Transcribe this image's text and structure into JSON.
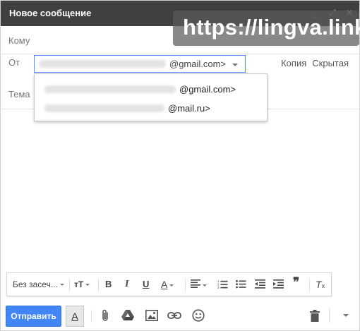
{
  "window": {
    "title": "Новое сообщение",
    "controls": [
      "minimize-icon",
      "expand-icon",
      "close-icon"
    ]
  },
  "watermark": {
    "text": "https://lingva.link"
  },
  "fields": {
    "to_label": "Кому",
    "from_label": "От",
    "from_value": "@gmail.com>",
    "cc_label": "Копия",
    "bcc_label": "Скрытая",
    "subject_label": "Тема"
  },
  "from_dropdown": {
    "options": [
      {
        "text": "@gmail.com>"
      },
      {
        "text": "@mail.ru>"
      }
    ]
  },
  "formatting": {
    "font_name": "Без засеч...",
    "icons": [
      "font-size-icon",
      "bold-icon",
      "italic-icon",
      "underline-icon",
      "text-color-icon",
      "align-icon",
      "numbered-list-icon",
      "bulleted-list-icon",
      "indent-less-icon",
      "indent-more-icon",
      "quote-icon",
      "remove-formatting-icon"
    ]
  },
  "bottom_toolbar": {
    "send_label": "Отправить",
    "format_toggle": "A",
    "icons": [
      "attach-icon",
      "drive-icon",
      "photo-icon",
      "link-icon",
      "emoji-icon",
      "trash-icon",
      "more-options-icon"
    ]
  },
  "colors": {
    "title_bar": "#404040",
    "send_button": "#4285f4",
    "focus_border": "#4d90fe"
  }
}
